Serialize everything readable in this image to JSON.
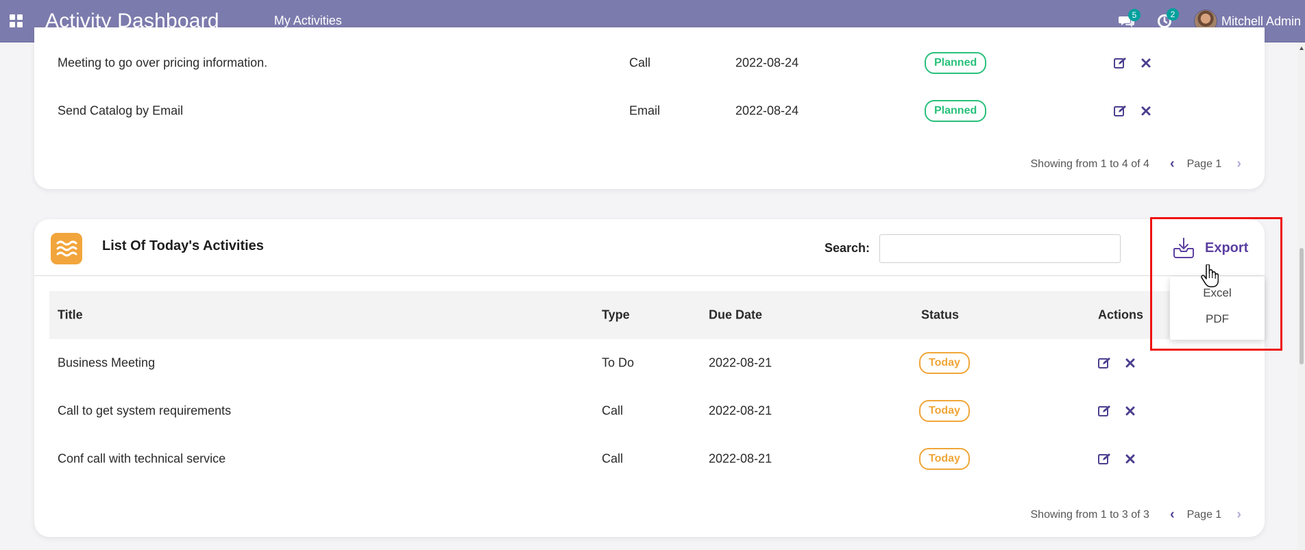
{
  "navbar": {
    "brand": "Activity Dashboard",
    "menu": "My Activities",
    "messages_badge": "5",
    "activities_badge": "2",
    "user_name": "Mitchell Admin"
  },
  "top_card": {
    "rows": [
      {
        "title": "Meeting to go over pricing information.",
        "type": "Call",
        "due": "2022-08-24",
        "status": "Planned"
      },
      {
        "title": "Send Catalog by Email",
        "type": "Email",
        "due": "2022-08-24",
        "status": "Planned"
      }
    ],
    "pager_text": "Showing from 1 to 4 of 4",
    "page_label": "Page 1"
  },
  "today_card": {
    "title": "List Of Today's Activities",
    "search_label": "Search:",
    "search_value": "",
    "export_label": "Export",
    "headers": {
      "title": "Title",
      "type": "Type",
      "due": "Due Date",
      "status": "Status",
      "actions": "Actions"
    },
    "rows": [
      {
        "title": "Business Meeting",
        "type": "To Do",
        "due": "2022-08-21",
        "status": "Today"
      },
      {
        "title": "Call to get system requirements",
        "type": "Call",
        "due": "2022-08-21",
        "status": "Today"
      },
      {
        "title": "Conf call with technical service",
        "type": "Call",
        "due": "2022-08-21",
        "status": "Today"
      }
    ],
    "pager_text": "Showing from 1 to 3 of 3",
    "page_label": "Page 1"
  },
  "export_menu": {
    "excel": "Excel",
    "pdf": "PDF"
  },
  "colors": {
    "navbar": "#7c7bad",
    "planned": "#28c07a",
    "today": "#f0a638",
    "action_icon": "#4b3f8f",
    "highlight": "#ee1111"
  },
  "icons": {
    "apps": "apps-grid-icon",
    "messages": "chat-bubbles-icon",
    "activities": "clock-icon",
    "edit": "edit-icon",
    "delete": "close-x-icon",
    "export": "inbox-download-icon",
    "card": "waves-icon",
    "cursor": "hand-pointer-icon"
  }
}
